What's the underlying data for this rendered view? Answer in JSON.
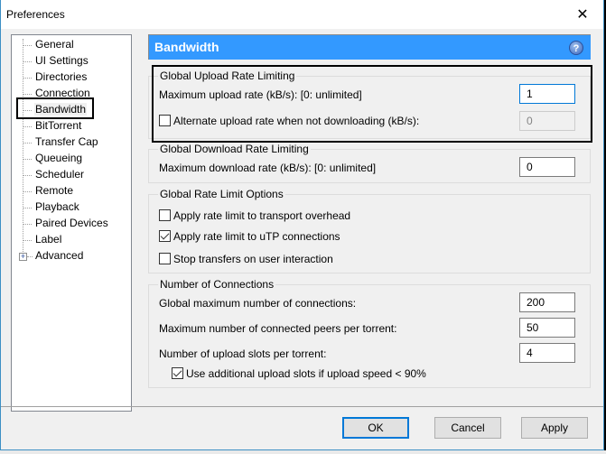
{
  "window": {
    "title": "Preferences",
    "close_label": "✕"
  },
  "sidebar": {
    "items": [
      {
        "label": "General"
      },
      {
        "label": "UI Settings"
      },
      {
        "label": "Directories"
      },
      {
        "label": "Connection"
      },
      {
        "label": "Bandwidth",
        "selected": true
      },
      {
        "label": "BitTorrent"
      },
      {
        "label": "Transfer Cap"
      },
      {
        "label": "Queueing"
      },
      {
        "label": "Scheduler"
      },
      {
        "label": "Remote"
      },
      {
        "label": "Playback"
      },
      {
        "label": "Paired Devices"
      },
      {
        "label": "Label"
      },
      {
        "label": "Advanced",
        "expandable": true
      }
    ],
    "expand_glyph": "+"
  },
  "panel": {
    "title": "Bandwidth",
    "help_glyph": "?",
    "header_color": "#3399ff"
  },
  "upload": {
    "group_title": "Global Upload Rate Limiting",
    "max_label": "Maximum upload rate (kB/s): [0: unlimited]",
    "max_value": "1",
    "alt_label": "Alternate upload rate when not downloading (kB/s):",
    "alt_checked": false,
    "alt_value": "0"
  },
  "download": {
    "group_title": "Global Download Rate Limiting",
    "max_label": "Maximum download rate (kB/s): [0: unlimited]",
    "max_value": "0"
  },
  "options": {
    "group_title": "Global Rate Limit Options",
    "items": [
      {
        "label": "Apply rate limit to transport overhead",
        "checked": false
      },
      {
        "label": "Apply rate limit to uTP connections",
        "checked": true
      },
      {
        "label": "Stop transfers on user interaction",
        "checked": false
      }
    ]
  },
  "connections": {
    "group_title": "Number of Connections",
    "global_max_label": "Global maximum number of connections:",
    "global_max_value": "200",
    "peers_label": "Maximum number of connected peers per torrent:",
    "peers_value": "50",
    "slots_label": "Number of upload slots per torrent:",
    "slots_value": "4",
    "additional_label": "Use additional upload slots if upload speed < 90%",
    "additional_checked": true
  },
  "footer": {
    "ok_label": "OK",
    "cancel_label": "Cancel",
    "apply_label": "Apply"
  }
}
